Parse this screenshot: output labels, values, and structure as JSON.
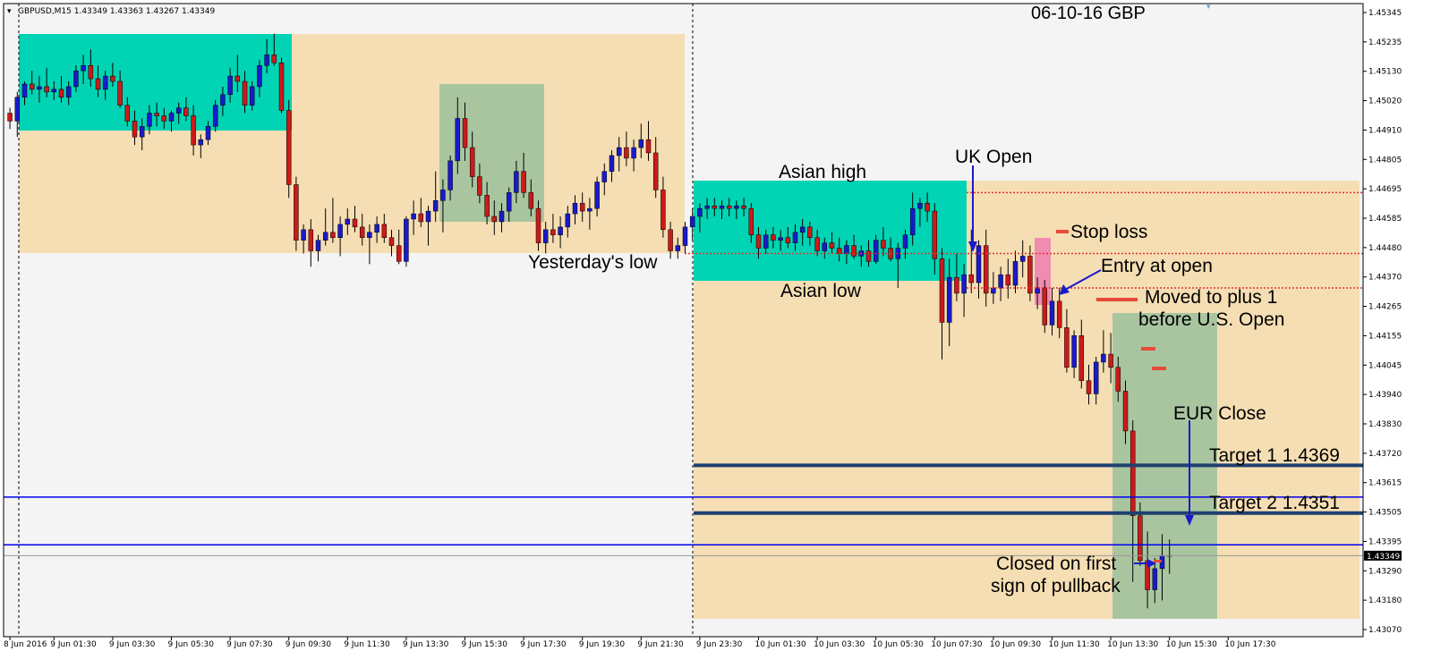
{
  "header": {
    "symbol_label": "GBPUSD,M15  1.43349 1.43363 1.43267 1.43349",
    "chart_title": "06-10-16  GBP"
  },
  "colors": {
    "background": "#f4f4f4",
    "session_zone": "#f5deb3",
    "asian_box": "#00d4b4",
    "eu_box": "#a9c5a0",
    "stop_box": "#f08cb0",
    "bull_candle": "#1a1acc",
    "bear_candle": "#cc1a1a",
    "target_line": "#1f3f6f",
    "blue_line": "#0000ee",
    "red_dotted": "#e03030",
    "arrow": "#1a1acc",
    "price_tag": "#000000"
  },
  "chart_data": {
    "type": "candlestick",
    "symbol": "GBPUSD",
    "timeframe": "M15",
    "current_price": "1.43349",
    "ylim": [
      1.4307,
      1.454
    ],
    "y_tick_labels": [
      "1.45345",
      "1.45235",
      "1.45130",
      "1.45020",
      "1.44910",
      "1.44805",
      "1.44695",
      "1.44585",
      "1.44480",
      "1.44370",
      "1.44265",
      "1.44155",
      "1.44045",
      "1.43940",
      "1.43830",
      "1.43720",
      "1.43615",
      "1.43505",
      "1.43395",
      "1.43290",
      "1.43180",
      "1.43070"
    ],
    "x_tick_labels": [
      "8 Jun 2016",
      "9 Jun 01:30",
      "9 Jun 03:30",
      "9 Jun 05:30",
      "9 Jun 07:30",
      "9 Jun 09:30",
      "9 Jun 11:30",
      "9 Jun 13:30",
      "9 Jun 15:30",
      "9 Jun 17:30",
      "9 Jun 19:30",
      "9 Jun 21:30",
      "9 Jun 23:30",
      "10 Jun 01:30",
      "10 Jun 03:30",
      "10 Jun 05:30",
      "10 Jun 07:30",
      "10 Jun 09:30",
      "10 Jun 11:30",
      "10 Jun 13:30",
      "10 Jun 15:30",
      "10 Jun 17:30"
    ],
    "x_tick_positions": [
      0,
      6,
      14,
      22,
      30,
      38,
      46,
      54,
      62,
      70,
      78,
      86,
      94,
      102,
      110,
      118,
      126,
      134,
      142,
      150,
      158,
      166
    ],
    "bars_total": 172,
    "candles": [
      [
        1.4502,
        1.4504,
        1.4496,
        1.4499
      ],
      [
        1.4499,
        1.451,
        1.4493,
        1.4508
      ],
      [
        1.4508,
        1.4514,
        1.4505,
        1.4513
      ],
      [
        1.4513,
        1.4518,
        1.4509,
        1.4511
      ],
      [
        1.4511,
        1.4516,
        1.4506,
        1.4512
      ],
      [
        1.4512,
        1.4519,
        1.4508,
        1.451
      ],
      [
        1.451,
        1.4514,
        1.4507,
        1.4511
      ],
      [
        1.4511,
        1.4516,
        1.4506,
        1.4508
      ],
      [
        1.4508,
        1.4514,
        1.4505,
        1.4512
      ],
      [
        1.4512,
        1.452,
        1.451,
        1.4518
      ],
      [
        1.4518,
        1.4524,
        1.4513,
        1.452
      ],
      [
        1.452,
        1.4526,
        1.4512,
        1.4515
      ],
      [
        1.4515,
        1.452,
        1.4508,
        1.4511
      ],
      [
        1.4511,
        1.4518,
        1.4507,
        1.4516
      ],
      [
        1.4516,
        1.4521,
        1.4512,
        1.4514
      ],
      [
        1.4514,
        1.4518,
        1.4504,
        1.4505
      ],
      [
        1.4505,
        1.4508,
        1.4497,
        1.4499
      ],
      [
        1.4499,
        1.4503,
        1.449,
        1.4493
      ],
      [
        1.4493,
        1.45,
        1.4488,
        1.4497
      ],
      [
        1.4497,
        1.4505,
        1.4494,
        1.4502
      ],
      [
        1.4502,
        1.4506,
        1.4497,
        1.4501
      ],
      [
        1.4501,
        1.4504,
        1.4496,
        1.4499
      ],
      [
        1.4499,
        1.4503,
        1.4495,
        1.4502
      ],
      [
        1.4502,
        1.4506,
        1.4498,
        1.4504
      ],
      [
        1.4504,
        1.4508,
        1.4499,
        1.4501
      ],
      [
        1.4501,
        1.4505,
        1.4486,
        1.449
      ],
      [
        1.449,
        1.4494,
        1.4485,
        1.4492
      ],
      [
        1.4492,
        1.4499,
        1.449,
        1.4497
      ],
      [
        1.4497,
        1.4507,
        1.4495,
        1.4505
      ],
      [
        1.4505,
        1.4512,
        1.4501,
        1.4509
      ],
      [
        1.4509,
        1.4519,
        1.4506,
        1.4516
      ],
      [
        1.4516,
        1.4524,
        1.451,
        1.4514
      ],
      [
        1.4514,
        1.4518,
        1.4502,
        1.4505
      ],
      [
        1.4505,
        1.4514,
        1.4503,
        1.4512
      ],
      [
        1.4512,
        1.4522,
        1.4508,
        1.452
      ],
      [
        1.452,
        1.453,
        1.4517,
        1.4524
      ],
      [
        1.4524,
        1.4532,
        1.452,
        1.4521
      ],
      [
        1.4521,
        1.4523,
        1.4502,
        1.4503
      ],
      [
        1.4503,
        1.4507,
        1.447,
        1.4475
      ],
      [
        1.4475,
        1.4478,
        1.445,
        1.4454
      ],
      [
        1.4454,
        1.446,
        1.4449,
        1.4458
      ],
      [
        1.4458,
        1.4462,
        1.4444,
        1.445
      ],
      [
        1.445,
        1.4456,
        1.4446,
        1.4454
      ],
      [
        1.4454,
        1.4466,
        1.4452,
        1.4457
      ],
      [
        1.4457,
        1.447,
        1.4453,
        1.4455
      ],
      [
        1.4455,
        1.4463,
        1.4448,
        1.446
      ],
      [
        1.446,
        1.4466,
        1.4456,
        1.4462
      ],
      [
        1.4462,
        1.4467,
        1.4457,
        1.4459
      ],
      [
        1.4459,
        1.4464,
        1.4452,
        1.4455
      ],
      [
        1.4455,
        1.446,
        1.4445,
        1.4457
      ],
      [
        1.4457,
        1.4463,
        1.4453,
        1.446
      ],
      [
        1.446,
        1.4464,
        1.4453,
        1.4455
      ],
      [
        1.4455,
        1.4458,
        1.4448,
        1.4452
      ],
      [
        1.4452,
        1.4458,
        1.4445,
        1.4446
      ],
      [
        1.4446,
        1.4463,
        1.4444,
        1.4462
      ],
      [
        1.4462,
        1.4469,
        1.4456,
        1.4464
      ],
      [
        1.4464,
        1.447,
        1.4459,
        1.4461
      ],
      [
        1.4461,
        1.4467,
        1.4452,
        1.4465
      ],
      [
        1.4465,
        1.448,
        1.4461,
        1.4469
      ],
      [
        1.4469,
        1.4477,
        1.4457,
        1.4473
      ],
      [
        1.4473,
        1.4486,
        1.4469,
        1.4484
      ],
      [
        1.4484,
        1.4508,
        1.4479,
        1.45
      ],
      [
        1.45,
        1.4506,
        1.4484,
        1.4489
      ],
      [
        1.4489,
        1.4495,
        1.4474,
        1.4478
      ],
      [
        1.4478,
        1.4483,
        1.4468,
        1.4471
      ],
      [
        1.4471,
        1.4476,
        1.446,
        1.4463
      ],
      [
        1.4463,
        1.4469,
        1.4456,
        1.4461
      ],
      [
        1.4461,
        1.4468,
        1.4457,
        1.4465
      ],
      [
        1.4465,
        1.4474,
        1.4461,
        1.4472
      ],
      [
        1.4472,
        1.4484,
        1.4468,
        1.448
      ],
      [
        1.448,
        1.4487,
        1.447,
        1.4472
      ],
      [
        1.4472,
        1.4477,
        1.4463,
        1.4466
      ],
      [
        1.4466,
        1.4469,
        1.445,
        1.4453
      ],
      [
        1.4453,
        1.4461,
        1.4449,
        1.4458
      ],
      [
        1.4458,
        1.4464,
        1.4453,
        1.4456
      ],
      [
        1.4456,
        1.4463,
        1.4451,
        1.4459
      ],
      [
        1.4459,
        1.4467,
        1.4455,
        1.4464
      ],
      [
        1.4464,
        1.4471,
        1.446,
        1.4468
      ],
      [
        1.4468,
        1.4472,
        1.4461,
        1.4465
      ],
      [
        1.4465,
        1.447,
        1.4458,
        1.4466
      ],
      [
        1.4466,
        1.4478,
        1.4463,
        1.4476
      ],
      [
        1.4476,
        1.4483,
        1.4471,
        1.448
      ],
      [
        1.448,
        1.4488,
        1.4476,
        1.4486
      ],
      [
        1.4486,
        1.4493,
        1.448,
        1.4489
      ],
      [
        1.4489,
        1.4495,
        1.4482,
        1.4485
      ],
      [
        1.4485,
        1.4492,
        1.448,
        1.4489
      ],
      [
        1.4489,
        1.4498,
        1.4485,
        1.4492
      ],
      [
        1.4492,
        1.4499,
        1.4484,
        1.4487
      ],
      [
        1.4487,
        1.4493,
        1.447,
        1.4473
      ],
      [
        1.4473,
        1.4478,
        1.4455,
        1.4458
      ],
      [
        1.4458,
        1.4461,
        1.4447,
        1.445
      ],
      [
        1.445,
        1.4455,
        1.4447,
        1.4452
      ],
      [
        1.4452,
        1.4461,
        1.4449,
        1.4459
      ],
      [
        1.4459,
        1.4466,
        1.4454,
        1.4463
      ],
      [
        1.4463,
        1.4468,
        1.4457,
        1.4466
      ],
      [
        1.4466,
        1.447,
        1.4462,
        1.4467
      ],
      [
        1.4467,
        1.447,
        1.4463,
        1.4466
      ],
      [
        1.4466,
        1.4469,
        1.4462,
        1.4467
      ],
      [
        1.4467,
        1.447,
        1.4463,
        1.4466
      ],
      [
        1.4466,
        1.4469,
        1.4462,
        1.4467
      ],
      [
        1.4467,
        1.447,
        1.4463,
        1.4466
      ],
      [
        1.4466,
        1.4468,
        1.4453,
        1.4456
      ],
      [
        1.4456,
        1.4459,
        1.4447,
        1.4451
      ],
      [
        1.4451,
        1.4458,
        1.4449,
        1.4456
      ],
      [
        1.4456,
        1.4459,
        1.4451,
        1.4454
      ],
      [
        1.4454,
        1.4458,
        1.445,
        1.4455
      ],
      [
        1.4455,
        1.4459,
        1.4451,
        1.4453
      ],
      [
        1.4453,
        1.446,
        1.445,
        1.4457
      ],
      [
        1.4457,
        1.4462,
        1.4452,
        1.4459
      ],
      [
        1.4459,
        1.4461,
        1.4452,
        1.4455
      ],
      [
        1.4455,
        1.4458,
        1.4448,
        1.445
      ],
      [
        1.445,
        1.4455,
        1.4447,
        1.4453
      ],
      [
        1.4453,
        1.4457,
        1.4449,
        1.4451
      ],
      [
        1.4451,
        1.4455,
        1.4446,
        1.4449
      ],
      [
        1.4449,
        1.4454,
        1.4445,
        1.4452
      ],
      [
        1.4452,
        1.4456,
        1.4447,
        1.4448
      ],
      [
        1.4448,
        1.4452,
        1.4444,
        1.445
      ],
      [
        1.445,
        1.4454,
        1.4444,
        1.4446
      ],
      [
        1.4446,
        1.4456,
        1.4445,
        1.4454
      ],
      [
        1.4454,
        1.4459,
        1.4448,
        1.4451
      ],
      [
        1.4451,
        1.4455,
        1.4446,
        1.4447
      ],
      [
        1.4447,
        1.4453,
        1.4436,
        1.4451
      ],
      [
        1.4451,
        1.4458,
        1.4447,
        1.4456
      ],
      [
        1.4456,
        1.4472,
        1.4452,
        1.4466
      ],
      [
        1.4466,
        1.447,
        1.4459,
        1.4468
      ],
      [
        1.4468,
        1.4472,
        1.4461,
        1.4465
      ],
      [
        1.4465,
        1.4468,
        1.4441,
        1.4447
      ],
      [
        1.4447,
        1.4451,
        1.4409,
        1.4423
      ],
      [
        1.4423,
        1.4447,
        1.4414,
        1.444
      ],
      [
        1.444,
        1.4449,
        1.4431,
        1.4434
      ],
      [
        1.4434,
        1.4445,
        1.4425,
        1.4441
      ],
      [
        1.4441,
        1.4458,
        1.4434,
        1.4438
      ],
      [
        1.4438,
        1.4454,
        1.4432,
        1.4452
      ],
      [
        1.4452,
        1.4458,
        1.4429,
        1.4434
      ],
      [
        1.4434,
        1.4442,
        1.443,
        1.4436
      ],
      [
        1.4436,
        1.4444,
        1.4431,
        1.4441
      ],
      [
        1.4441,
        1.4447,
        1.4432,
        1.4437
      ],
      [
        1.4437,
        1.445,
        1.4434,
        1.4446
      ],
      [
        1.4446,
        1.4454,
        1.444,
        1.4448
      ],
      [
        1.4448,
        1.4452,
        1.4431,
        1.4434
      ],
      [
        1.4434,
        1.444,
        1.4428,
        1.4436
      ],
      [
        1.4436,
        1.4439,
        1.4419,
        1.4422
      ],
      [
        1.4422,
        1.4436,
        1.4418,
        1.4431
      ],
      [
        1.4431,
        1.4436,
        1.4417,
        1.4421
      ],
      [
        1.4421,
        1.4428,
        1.4404,
        1.4406
      ],
      [
        1.4406,
        1.442,
        1.4402,
        1.4418
      ],
      [
        1.4418,
        1.4424,
        1.4398,
        1.4401
      ],
      [
        1.4401,
        1.4407,
        1.4392,
        1.4396
      ],
      [
        1.4396,
        1.441,
        1.4392,
        1.4408
      ],
      [
        1.4408,
        1.442,
        1.4404,
        1.4411
      ],
      [
        1.4411,
        1.4419,
        1.44,
        1.4406
      ],
      [
        1.4406,
        1.441,
        1.4393,
        1.4397
      ],
      [
        1.4397,
        1.4401,
        1.4377,
        1.4382
      ],
      [
        1.4382,
        1.4386,
        1.4325,
        1.435
      ],
      [
        1.435,
        1.4355,
        1.4331,
        1.4333
      ],
      [
        1.4333,
        1.4344,
        1.4315,
        1.4322
      ],
      [
        1.4322,
        1.4334,
        1.4317,
        1.433
      ],
      [
        1.433,
        1.4343,
        1.4318,
        1.4335
      ],
      [
        1.4335,
        1.4341,
        1.4328,
        1.4335
      ]
    ],
    "lines": {
      "asian_high_dotted": 1.4472,
      "asian_low_dotted": 1.4436,
      "stop_loss_dotted": 1.4449,
      "target_1": 1.4369,
      "target_2": 1.4351,
      "blue_line_upper": 1.4357,
      "blue_line_lower": 1.4339,
      "current_price_line": 1.43349
    }
  },
  "annotations": {
    "uk_open": "UK Open",
    "asian_high": "Asian high",
    "asian_low": "Asian low",
    "yesterdays_low": "Yesterday's low",
    "stop_loss": "Stop loss",
    "entry": "Entry at open",
    "moved_1": "Moved to plus 1",
    "moved_2": "before U.S. Open",
    "eur_close": "EUR Close",
    "target_1": "Target 1  1.4369",
    "target_2": "Target 2  1.4351",
    "closed_1": "Closed on first",
    "closed_2": "sign of pullback",
    "price_tag": "1.43349"
  }
}
